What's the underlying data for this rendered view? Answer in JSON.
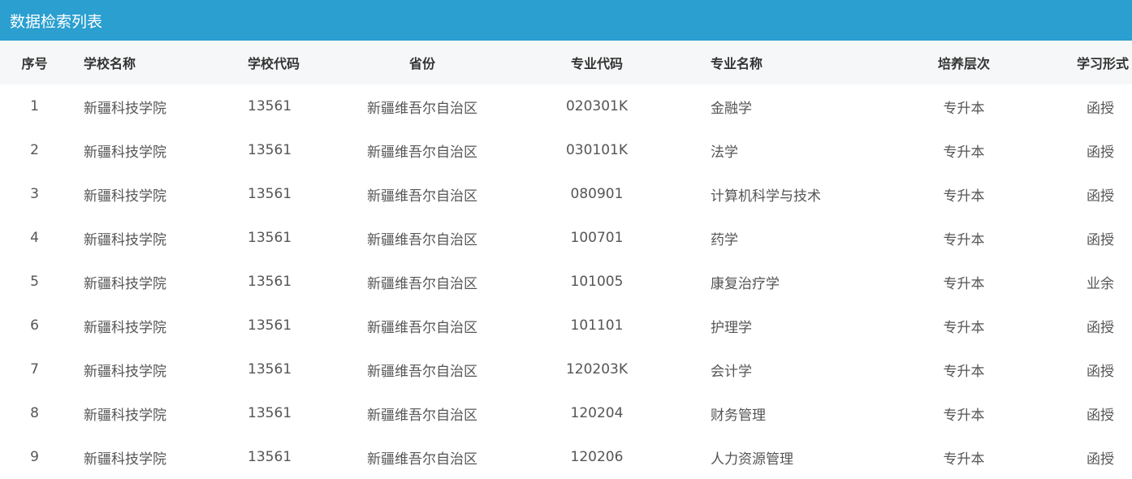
{
  "panel": {
    "title": "数据检索列表"
  },
  "table": {
    "headers": {
      "index": "序号",
      "school_name": "学校名称",
      "school_code": "学校代码",
      "province": "省份",
      "major_code": "专业代码",
      "major_name": "专业名称",
      "level": "培养层次",
      "study_mode": "学习形式"
    },
    "rows": [
      {
        "index": "1",
        "school_name": "新疆科技学院",
        "school_code": "13561",
        "province": "新疆维吾尔自治区",
        "major_code": "020301K",
        "major_name": "金融学",
        "level": "专升本",
        "study_mode": "函授"
      },
      {
        "index": "2",
        "school_name": "新疆科技学院",
        "school_code": "13561",
        "province": "新疆维吾尔自治区",
        "major_code": "030101K",
        "major_name": "法学",
        "level": "专升本",
        "study_mode": "函授"
      },
      {
        "index": "3",
        "school_name": "新疆科技学院",
        "school_code": "13561",
        "province": "新疆维吾尔自治区",
        "major_code": "080901",
        "major_name": "计算机科学与技术",
        "level": "专升本",
        "study_mode": "函授"
      },
      {
        "index": "4",
        "school_name": "新疆科技学院",
        "school_code": "13561",
        "province": "新疆维吾尔自治区",
        "major_code": "100701",
        "major_name": "药学",
        "level": "专升本",
        "study_mode": "函授"
      },
      {
        "index": "5",
        "school_name": "新疆科技学院",
        "school_code": "13561",
        "province": "新疆维吾尔自治区",
        "major_code": "101005",
        "major_name": "康复治疗学",
        "level": "专升本",
        "study_mode": "业余"
      },
      {
        "index": "6",
        "school_name": "新疆科技学院",
        "school_code": "13561",
        "province": "新疆维吾尔自治区",
        "major_code": "101101",
        "major_name": "护理学",
        "level": "专升本",
        "study_mode": "函授"
      },
      {
        "index": "7",
        "school_name": "新疆科技学院",
        "school_code": "13561",
        "province": "新疆维吾尔自治区",
        "major_code": "120203K",
        "major_name": "会计学",
        "level": "专升本",
        "study_mode": "函授"
      },
      {
        "index": "8",
        "school_name": "新疆科技学院",
        "school_code": "13561",
        "province": "新疆维吾尔自治区",
        "major_code": "120204",
        "major_name": "财务管理",
        "level": "专升本",
        "study_mode": "函授"
      },
      {
        "index": "9",
        "school_name": "新疆科技学院",
        "school_code": "13561",
        "province": "新疆维吾尔自治区",
        "major_code": "120206",
        "major_name": "人力资源管理",
        "level": "专升本",
        "study_mode": "函授"
      }
    ]
  },
  "colors": {
    "header_bar": "#2a9fd0",
    "table_head_bg": "#f6f7f8",
    "text": "#555555"
  }
}
